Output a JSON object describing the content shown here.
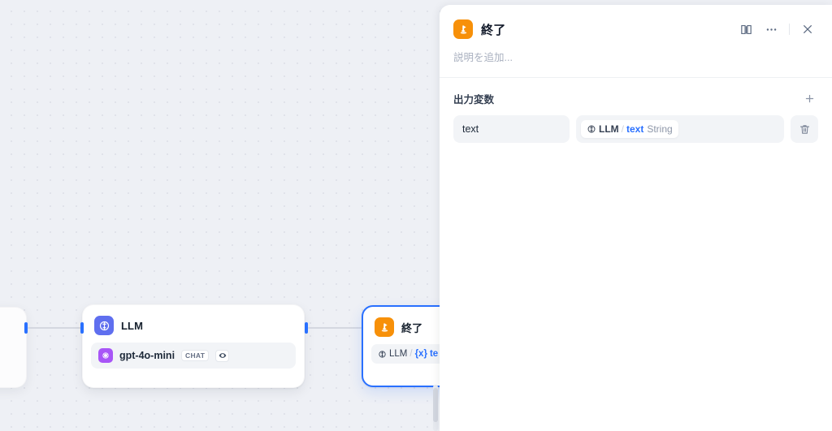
{
  "canvas": {
    "nodes": [
      {
        "id": "left-partial",
        "title": "",
        "icon": "node-partial-icon"
      },
      {
        "id": "llm",
        "title": "LLM",
        "icon": "llm-brain-icon",
        "icon_color": "#5f6fef",
        "model": {
          "name": "gpt-4o-mini",
          "logo": "openai-logo-icon",
          "logo_color": "#a855f7",
          "badge": "CHAT",
          "vision_icon": "eye-icon"
        }
      },
      {
        "id": "end",
        "title": "終了",
        "icon": "end-flag-icon",
        "icon_color": "#f79009",
        "variable": {
          "source": "LLM",
          "separator": "/",
          "brace": "{x}",
          "name": "te"
        }
      }
    ]
  },
  "panel": {
    "icon": "end-flag-icon",
    "icon_color": "#f79009",
    "title": "終了",
    "actions": {
      "help": "book-icon",
      "more": "more-horizontal-icon",
      "close": "close-icon"
    },
    "description_placeholder": "説明を追加...",
    "output_section": {
      "title": "出力変数",
      "add_icon": "plus-icon",
      "rows": [
        {
          "key": "text",
          "value": {
            "icon": "llm-brain-icon",
            "source": "LLM",
            "separator": "/",
            "name": "text",
            "type": "String"
          },
          "delete_icon": "trash-icon"
        }
      ]
    }
  },
  "colors": {
    "accent_blue": "#2970ff",
    "end_orange": "#f79009",
    "llm_purple": "#5f6fef",
    "canvas_bg": "#eef0f5"
  }
}
